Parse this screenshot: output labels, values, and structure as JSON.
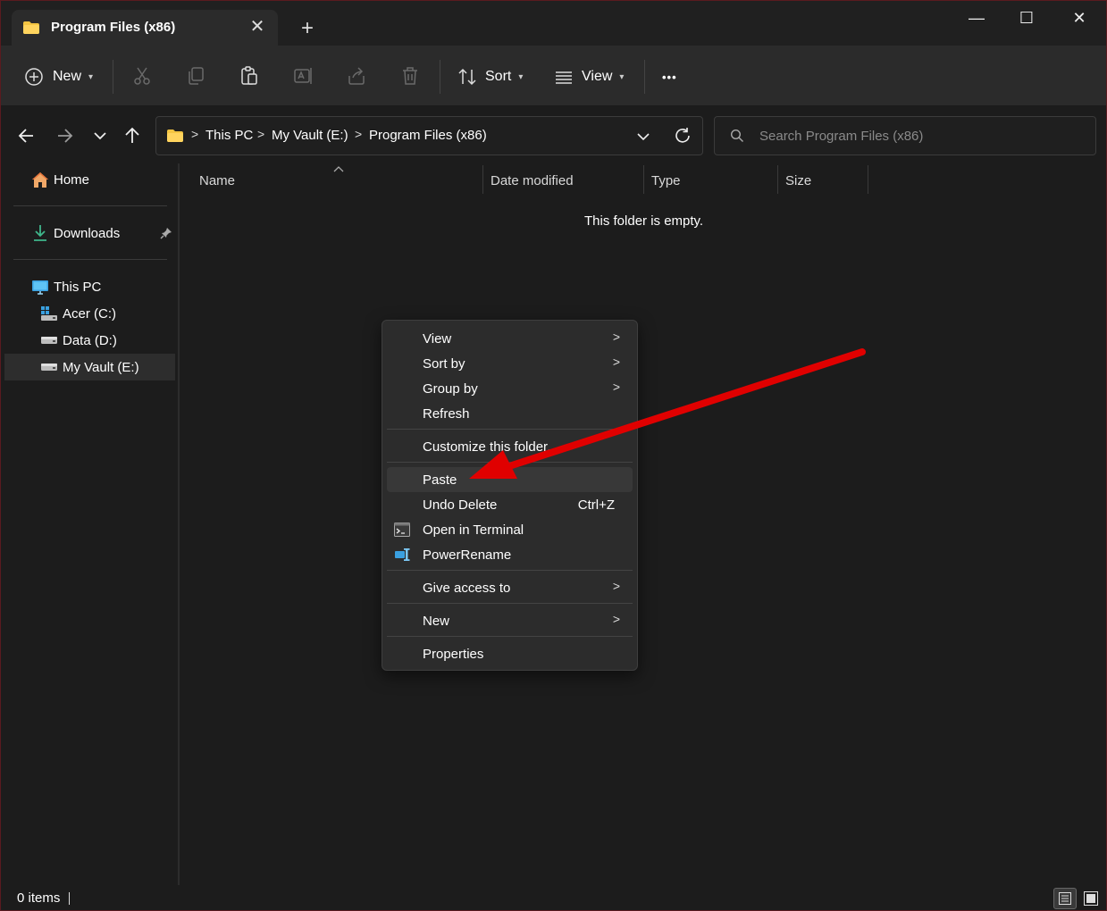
{
  "window": {
    "tab_title": "Program Files (x86)",
    "close_tab_glyph": "✕",
    "new_tab_glyph": "+",
    "controls": {
      "minimize": "—",
      "maximize": "☐",
      "close": "✕"
    }
  },
  "toolbar": {
    "new_label": "New",
    "sort_label": "Sort",
    "view_label": "View",
    "more_glyph": "•••",
    "icons": [
      "plus-circle-icon",
      "cut-icon",
      "copy-icon",
      "paste-icon",
      "rename-icon",
      "share-icon",
      "delete-icon",
      "sort-icon",
      "view-icon",
      "more-icon"
    ]
  },
  "address": {
    "crumbs": [
      "This PC",
      "My Vault (E:)",
      "Program Files (x86)"
    ],
    "separator": ">"
  },
  "search": {
    "placeholder": "Search Program Files (x86)"
  },
  "sidebar": {
    "home": "Home",
    "downloads": "Downloads",
    "this_pc": "This PC",
    "drives": [
      "Acer (C:)",
      "Data (D:)",
      "My Vault (E:)"
    ]
  },
  "columns": {
    "name": "Name",
    "date": "Date modified",
    "type": "Type",
    "size": "Size"
  },
  "content": {
    "empty_message": "This folder is empty."
  },
  "status": {
    "items": "0 items"
  },
  "context_menu": {
    "items": [
      {
        "label": "View",
        "submenu": true
      },
      {
        "label": "Sort by",
        "submenu": true
      },
      {
        "label": "Group by",
        "submenu": true
      },
      {
        "label": "Refresh"
      },
      {
        "label": "Customize this folder..."
      },
      {
        "label": "Paste",
        "highlighted": true
      },
      {
        "label": "Undo Delete",
        "accelerator": "Ctrl+Z"
      },
      {
        "label": "Open in Terminal",
        "icon": "terminal-icon"
      },
      {
        "label": "PowerRename",
        "icon": "powerrename-icon"
      },
      {
        "label": "Give access to",
        "submenu": true
      },
      {
        "label": "New",
        "submenu": true
      },
      {
        "label": "Properties"
      }
    ],
    "arrow_glyph": ">"
  },
  "colors": {
    "accent_folder": "#f4c542",
    "annotation_arrow": "#e00000",
    "drive_blue": "#3aa0e0"
  }
}
